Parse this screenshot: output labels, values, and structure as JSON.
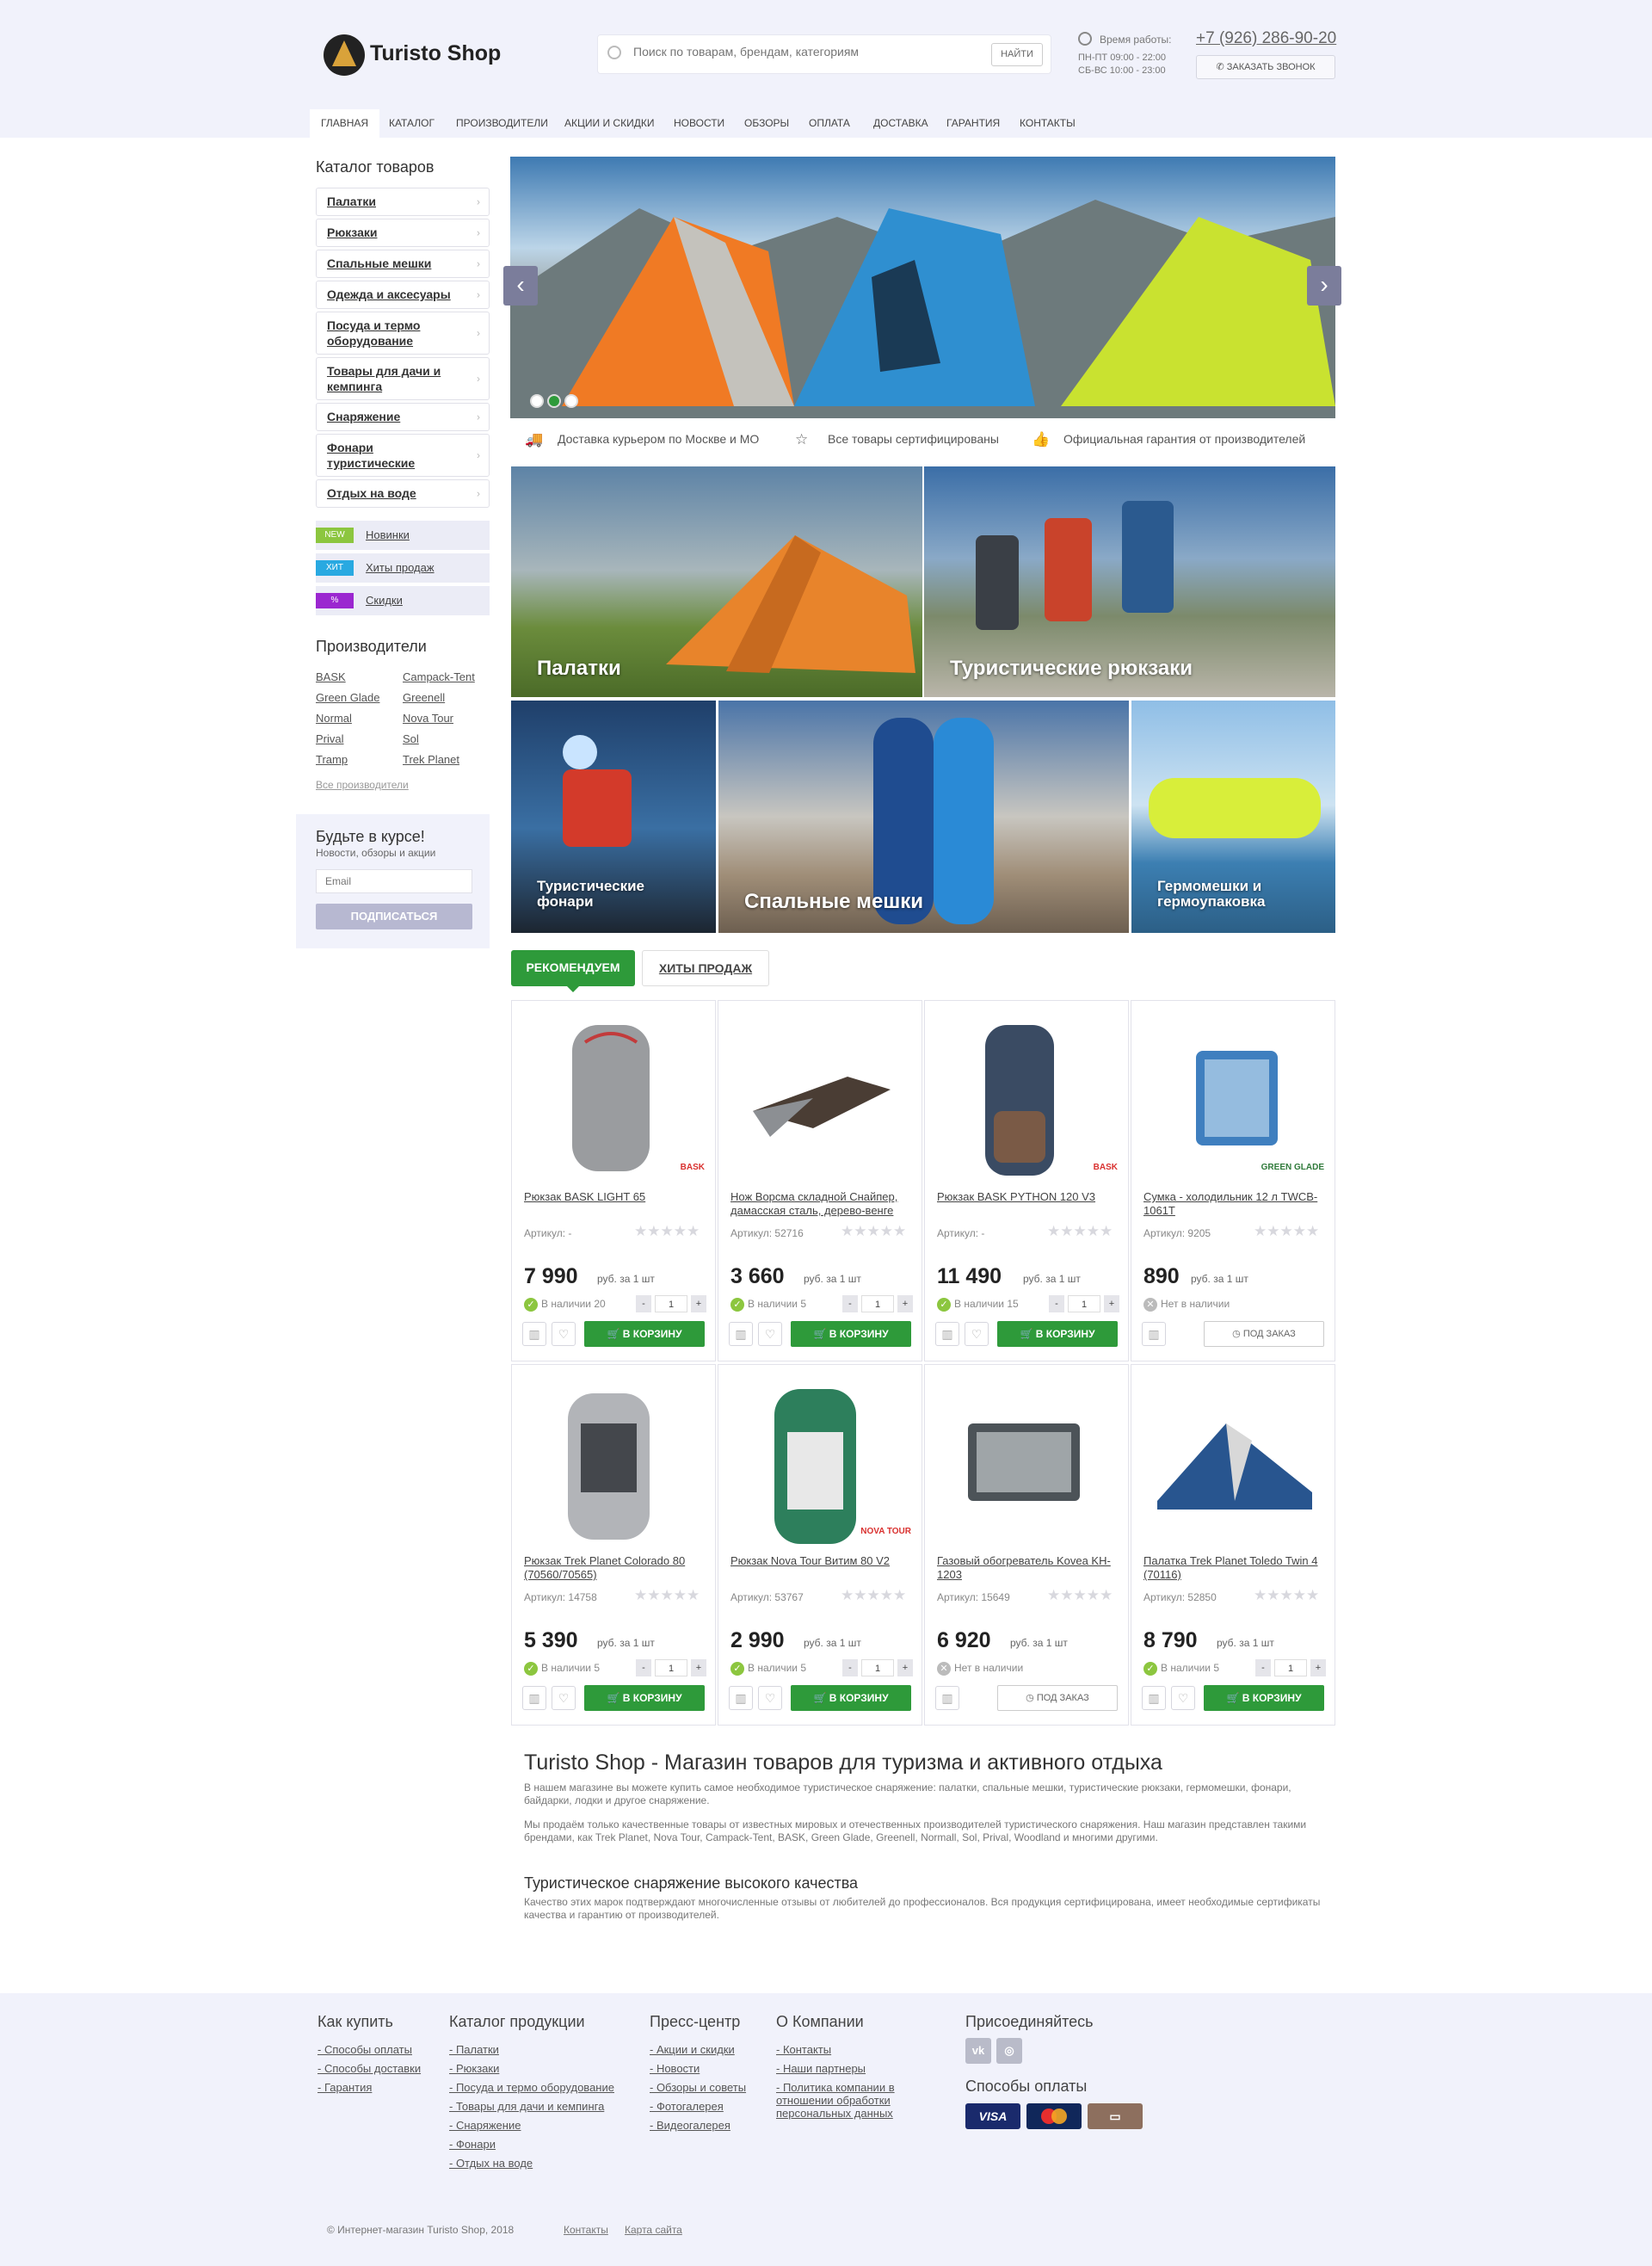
{
  "header": {
    "logo_text": "Turisto Shop",
    "search_placeholder": "Поиск по товарам, брендам, категориям",
    "search_button": "НАЙТИ",
    "hours_title": "Время работы:",
    "hours_weekdays": "ПН-ПТ 09:00 - 22:00",
    "hours_weekend": "СБ-ВС 10:00 - 23:00",
    "phone": "+7 (926) 286-90-20",
    "callback_button": "ЗАКАЗАТЬ ЗВОНОК"
  },
  "nav": [
    "ГЛАВНАЯ",
    "КАТАЛОГ",
    "ПРОИЗВОДИТЕЛИ",
    "АКЦИИ И СКИДКИ",
    "НОВОСТИ",
    "ОБЗОРЫ",
    "ОПЛАТА",
    "ДОСТАВКА",
    "ГАРАНТИЯ",
    "КОНТАКТЫ"
  ],
  "sidebar": {
    "catalog_title": "Каталог товаров",
    "categories": [
      "Палатки",
      "Рюкзаки",
      "Спальные мешки",
      "Одежда и аксесуары",
      "Посуда и термо оборудование",
      "Товары для дачи и кемпинга",
      "Снаряжение",
      "Фонари туристические",
      "Отдых на воде"
    ],
    "tags": [
      {
        "tag": "NEW",
        "label": "Новинки",
        "color": "#8cc63f"
      },
      {
        "tag": "ХИТ",
        "label": "Хиты продаж",
        "color": "#29a9e1"
      },
      {
        "tag": "%",
        "label": "Скидки",
        "color": "#9b27d0"
      }
    ],
    "brands_title": "Производители",
    "brands": [
      "BASK",
      "Campack-Tent",
      "Green Glade",
      "Greenell",
      "Normal",
      "Nova Tour",
      "Prival",
      "Sol",
      "Tramp",
      "Trek Planet"
    ],
    "all_brands": "Все производители",
    "newsletter": {
      "title": "Будьте в курсе!",
      "subtitle": "Новости, обзоры и акции",
      "email_placeholder": "Email",
      "button": "ПОДПИСАТЬСЯ"
    }
  },
  "features": [
    "Доставка курьером по Москве и МО",
    "Все товары сертифицированы",
    "Официальная гарантия от производителей"
  ],
  "category_tiles": [
    "Палатки",
    "Туристические рюкзаки",
    "Туристические фонари",
    "Спальные мешки",
    "Гермомешки и гермоупаковка"
  ],
  "tabs": [
    "РЕКОМЕНДУЕМ",
    "ХИТЫ ПРОДАЖ"
  ],
  "products": [
    {
      "name": "Рюкзак BASK LIGHT 65",
      "article": "Артикул: -",
      "price": "7 990",
      "unit": "руб. за 1 шт",
      "stock": "В наличии 20",
      "in_stock": true,
      "qty": "1",
      "brand": "BASK"
    },
    {
      "name": "Нож Ворсма складной Снайпер, дамасская сталь, дерево-венге",
      "article": "Артикул: 52716",
      "price": "3 660",
      "unit": "руб. за 1 шт",
      "stock": "В наличии 5",
      "in_stock": true,
      "qty": "1",
      "brand": ""
    },
    {
      "name": "Рюкзак BASK PYTHON 120 V3",
      "article": "Артикул: -",
      "price": "11 490",
      "unit": "руб. за 1 шт",
      "stock": "В наличии 15",
      "in_stock": true,
      "qty": "1",
      "brand": "BASK"
    },
    {
      "name": "Сумка - холодильник 12 л TWCB-1061T",
      "article": "Артикул: 9205",
      "price": "890",
      "unit": "руб. за 1 шт",
      "stock": "Нет в наличии",
      "in_stock": false,
      "qty": "1",
      "brand": "GREEN GLADE"
    },
    {
      "name": "Рюкзак Trek Planet Colorado 80 (70560/70565)",
      "article": "Артикул: 14758",
      "price": "5 390",
      "unit": "руб. за 1 шт",
      "stock": "В наличии 5",
      "in_stock": true,
      "qty": "1",
      "brand": ""
    },
    {
      "name": "Рюкзак Nova Tour Витим 80 V2",
      "article": "Артикул: 53767",
      "price": "2 990",
      "unit": "руб. за 1 шт",
      "stock": "В наличии 5",
      "in_stock": true,
      "qty": "1",
      "brand": "NOVA TOUR"
    },
    {
      "name": "Газовый обогреватель Kovea KH-1203",
      "article": "Артикул: 15649",
      "price": "6 920",
      "unit": "руб. за 1 шт",
      "stock": "Нет в наличии",
      "in_stock": false,
      "qty": "1",
      "brand": ""
    },
    {
      "name": "Палатка Trek Planet Toledo Twin 4 (70116)",
      "article": "Артикул: 52850",
      "price": "8 790",
      "unit": "руб. за 1 шт",
      "stock": "В наличии 5",
      "in_stock": true,
      "qty": "1",
      "brand": ""
    }
  ],
  "buttons": {
    "cart": "В КОРЗИНУ",
    "order": "ПОД ЗАКАЗ"
  },
  "seo": {
    "title": "Turisto Shop - Магазин товаров для туризма и активного отдыха",
    "p1": "В нашем магазине вы можете купить самое необходимое туристическое снаряжение: палатки, спальные мешки, туристические рюкзаки, гермомешки, фонари, байдарки, лодки и другое снаряжение.",
    "p2": "Мы продаём только качественные товары от известных мировых и отечественных производителей туристического снаряжения. Наш магазин представлен такими брендами, как Trek Planet, Nova Tour, Campack-Tent, BASK, Green Glade, Greenell, Normall, Sol, Prival, Woodland и многими другими.",
    "h2": "Туристическое снаряжение высокого качества",
    "p3": "Качество этих марок подтверждают многочисленные отзывы от любителей до профессионалов. Вся продукция сертифицирована, имеет необходимые сертификаты качества и гарантию от производителей."
  },
  "footer": {
    "how_title": "Как купить",
    "how_links": [
      "Способы оплаты",
      "Способы доставки",
      "Гарантия"
    ],
    "catalog_title": "Каталог продукции",
    "catalog_links": [
      "Палатки",
      "Рюкзаки",
      "Посуда и термо оборудование",
      "Товары для дачи и кемпинга",
      "Снаряжение",
      "Фонари",
      "Отдых на воде"
    ],
    "press_title": "Пресс-центр",
    "press_links": [
      "Акции и скидки",
      "Новости",
      "Обзоры и советы",
      "Фотогалерея",
      "Видеогалерея"
    ],
    "about_title": "О Компании",
    "about_links": [
      "Контакты",
      "Наши партнеры",
      "Политика компании в отношении обработки персональных данных"
    ],
    "join_title": "Присоединяйтесь",
    "payment_title": "Способы оплаты",
    "copyright": "© Интернет-магазин Turisto Shop, 2018",
    "bottom_links": [
      "Контакты",
      "Карта сайта"
    ]
  }
}
